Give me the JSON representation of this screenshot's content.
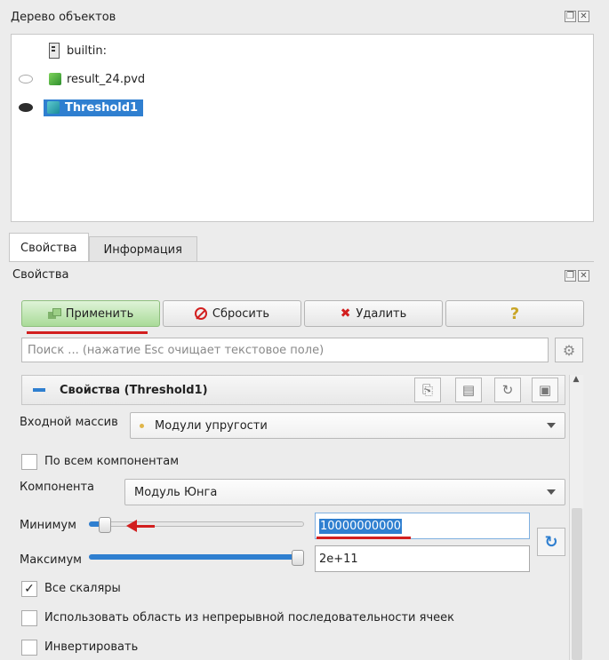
{
  "pipeline_browser": {
    "title": "Дерево объектов",
    "items": [
      {
        "label": "builtin:"
      },
      {
        "label": "result_24.pvd"
      },
      {
        "label": "Threshold1"
      }
    ]
  },
  "tabs": [
    {
      "label": "Свойства"
    },
    {
      "label": "Информация"
    }
  ],
  "properties_panel": {
    "title": "Свойства",
    "buttons": {
      "apply": "Применить",
      "reset": "Сбросить",
      "delete": "Удалить",
      "help": "?"
    },
    "search_placeholder": "Поиск ... (нажатие Esc очищает текстовое поле)",
    "section_title": "Свойства (Threshold1)",
    "input_array": {
      "label": "Входной массив",
      "value": "Модули упругости"
    },
    "all_components": {
      "label": "По всем компонентам",
      "checked": false
    },
    "component": {
      "label": "Компонента",
      "value": "Модуль Юнга"
    },
    "minimum": {
      "label": "Минимум",
      "value": "10000000000",
      "slider_fraction": 0.05
    },
    "maximum": {
      "label": "Максимум",
      "value": "2e+11",
      "slider_fraction": 1.0
    },
    "all_scalars": {
      "label": "Все скаляры",
      "checked": true,
      "mark": "✓"
    },
    "use_continuous": {
      "label": "Использовать область из непрерывной последовательности ячеек",
      "checked": false
    },
    "invert": {
      "label": "Инвертировать",
      "checked": false
    }
  },
  "colors": {
    "accent": "#2f7fd0",
    "annotation_red": "#d21f1f",
    "apply_green": "#a9db98"
  }
}
